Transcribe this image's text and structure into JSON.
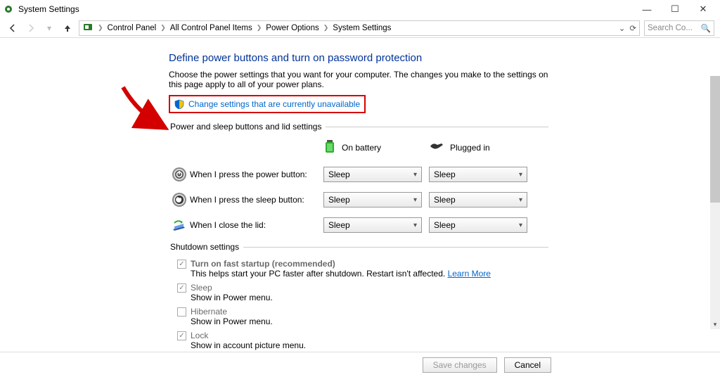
{
  "window": {
    "title": "System Settings"
  },
  "breadcrumb": [
    "Control Panel",
    "All Control Panel Items",
    "Power Options",
    "System Settings"
  ],
  "search": {
    "placeholder": "Search Co..."
  },
  "page": {
    "title": "Define power buttons and turn on password protection",
    "subtitle": "Choose the power settings that you want for your computer. The changes you make to the settings on this page apply to all of your power plans.",
    "change_link": "Change settings that are currently unavailable"
  },
  "columns": {
    "battery": "On battery",
    "plugged": "Plugged in"
  },
  "button_section": {
    "legend": "Power and sleep buttons and lid settings",
    "rows": [
      {
        "label": "When I press the power button:",
        "battery": "Sleep",
        "plugged": "Sleep"
      },
      {
        "label": "When I press the sleep button:",
        "battery": "Sleep",
        "plugged": "Sleep"
      },
      {
        "label": "When I close the lid:",
        "battery": "Sleep",
        "plugged": "Sleep"
      }
    ]
  },
  "shutdown_section": {
    "legend": "Shutdown settings",
    "items": [
      {
        "label": "Turn on fast startup (recommended)",
        "checked": true,
        "desc_prefix": "This helps start your PC faster after shutdown. Restart isn't affected. ",
        "learn_more": "Learn More",
        "strong": true
      },
      {
        "label": "Sleep",
        "checked": true,
        "desc": "Show in Power menu."
      },
      {
        "label": "Hibernate",
        "checked": false,
        "desc": "Show in Power menu."
      },
      {
        "label": "Lock",
        "checked": true,
        "desc": "Show in account picture menu."
      }
    ]
  },
  "footer": {
    "save": "Save changes",
    "cancel": "Cancel"
  }
}
